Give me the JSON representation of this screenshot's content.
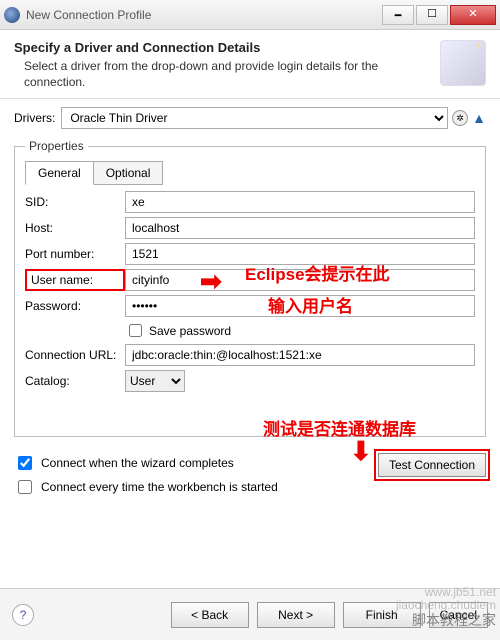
{
  "window": {
    "title": "New Connection Profile"
  },
  "banner": {
    "heading": "Specify a Driver and Connection Details",
    "subtext": "Select a driver from the drop-down and provide login details for the connection."
  },
  "drivers": {
    "label": "Drivers:",
    "selected": "Oracle Thin Driver"
  },
  "properties": {
    "legend": "Properties",
    "tabs": {
      "general": "General",
      "optional": "Optional"
    },
    "fields": {
      "sid": {
        "label": "SID:",
        "value": "xe"
      },
      "host": {
        "label": "Host:",
        "value": "localhost"
      },
      "port": {
        "label": "Port number:",
        "value": "1521"
      },
      "user": {
        "label": "User name:",
        "value": "cityinfo"
      },
      "password": {
        "label": "Password:",
        "value": "••••••"
      },
      "save_pw": {
        "label": "Save password",
        "checked": false
      },
      "conn_url": {
        "label": "Connection URL:",
        "value": "jdbc:oracle:thin:@localhost:1521:xe"
      },
      "catalog": {
        "label": "Catalog:",
        "value": "User"
      }
    }
  },
  "annotations": {
    "hint_top1": "Eclipse会提示在此",
    "hint_top2": "输入用户名",
    "hint_bottom": "测试是否连通数据库"
  },
  "checks": {
    "connect_on_complete": {
      "label": "Connect when the wizard completes",
      "checked": true
    },
    "connect_every_start": {
      "label": "Connect every time the workbench is started",
      "checked": false
    }
  },
  "buttons": {
    "test": "Test Connection",
    "back": "< Back",
    "next": "Next >",
    "finish": "Finish",
    "cancel": "Cancel"
  },
  "watermark": {
    "line1": "www.jb51.net",
    "line2": "jiaocheng.chudiem",
    "zh": "脚本教程之家"
  }
}
